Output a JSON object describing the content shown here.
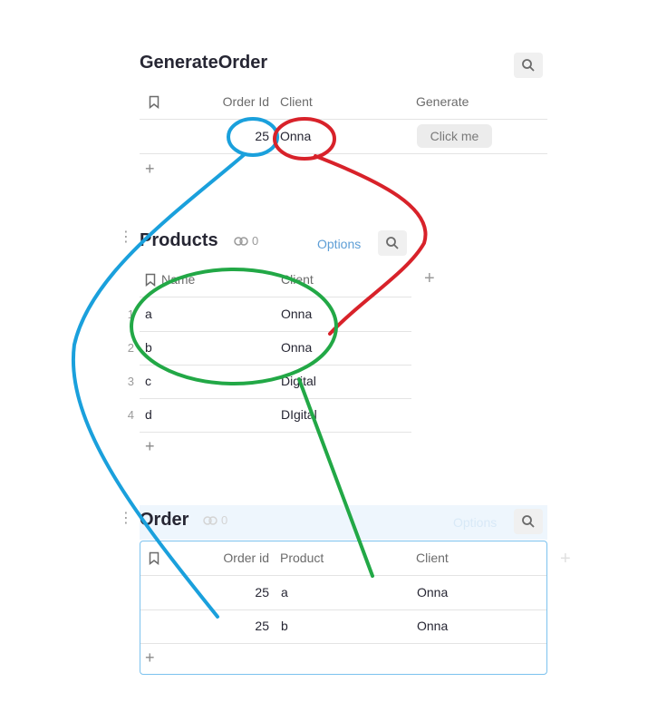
{
  "generate_order": {
    "title": "GenerateOrder",
    "columns": [
      "Order Id",
      "Client",
      "Generate"
    ],
    "rows": [
      {
        "order_id": "25",
        "client": "Onna",
        "button": "Click me"
      }
    ],
    "add": "+"
  },
  "products": {
    "title": "Products",
    "link_count": "0",
    "options": "Options",
    "columns": [
      "Name",
      "Client"
    ],
    "rows": [
      {
        "num": "1",
        "name": "a",
        "client": "Onna"
      },
      {
        "num": "2",
        "name": "b",
        "client": "Onna"
      },
      {
        "num": "3",
        "name": "c",
        "client": "Digital"
      },
      {
        "num": "4",
        "name": "d",
        "client": "DIgital"
      }
    ],
    "add": "+",
    "add_column": "+"
  },
  "order": {
    "title": "Order",
    "link_count": "0",
    "options": "Options",
    "columns": [
      "Order id",
      "Product",
      "Client"
    ],
    "rows": [
      {
        "order_id": "25",
        "product": "a",
        "client": "Onna"
      },
      {
        "order_id": "25",
        "product": "b",
        "client": "Onna"
      }
    ],
    "add": "+",
    "add_column": "+"
  },
  "annotation_colors": {
    "blue": "#1aa0dc",
    "red": "#d8222a",
    "green": "#22a846"
  }
}
